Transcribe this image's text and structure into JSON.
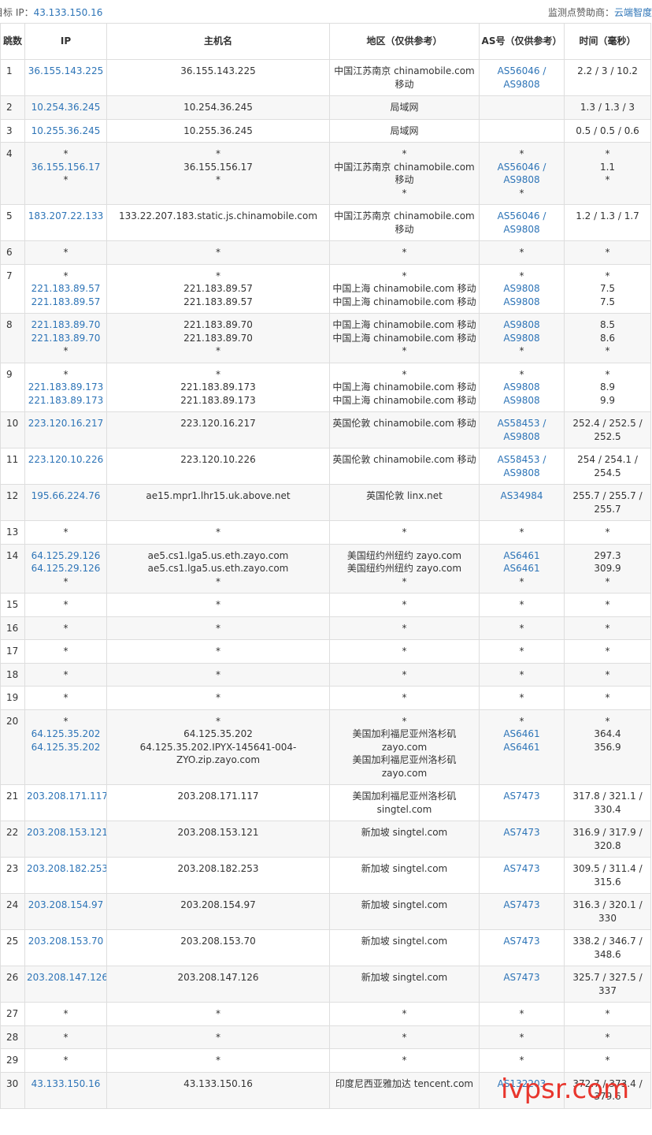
{
  "topbar": {
    "target_label": "目标 IP：",
    "target_ip": "43.133.150.16",
    "sponsor_label": "监测点赞助商：",
    "sponsor_name": "云端智度"
  },
  "table": {
    "headers": [
      "跳数",
      "IP",
      "主机名",
      "地区（仅供参考）",
      "AS号（仅供参考）",
      "时间（毫秒）"
    ],
    "rows": [
      {
        "hop": "1",
        "ip": [
          "36.155.143.225"
        ],
        "host": [
          "36.155.143.225"
        ],
        "region": [
          "中国江苏南京 chinamobile.com 移动"
        ],
        "as": [
          "AS56046 /",
          "AS9808"
        ],
        "time": [
          "2.2 / 3 / 10.2"
        ]
      },
      {
        "hop": "2",
        "ip": [
          "10.254.36.245"
        ],
        "host": [
          "10.254.36.245"
        ],
        "region": [
          "局域网"
        ],
        "as": [],
        "time": [
          "1.3 / 1.3 / 3"
        ]
      },
      {
        "hop": "3",
        "ip": [
          "10.255.36.245"
        ],
        "host": [
          "10.255.36.245"
        ],
        "region": [
          "局域网"
        ],
        "as": [],
        "time": [
          "0.5 / 0.5 / 0.6"
        ]
      },
      {
        "hop": "4",
        "ip": [
          "*",
          "36.155.156.17",
          "*"
        ],
        "host": [
          "*",
          "36.155.156.17",
          "*"
        ],
        "region": [
          "*",
          "中国江苏南京 chinamobile.com 移动",
          "*"
        ],
        "as": [
          "*",
          "AS56046 /",
          "AS9808",
          "*"
        ],
        "time": [
          "*",
          "1.1",
          "*"
        ]
      },
      {
        "hop": "5",
        "ip": [
          "183.207.22.133"
        ],
        "host": [
          "133.22.207.183.static.js.chinamobile.com"
        ],
        "region": [
          "中国江苏南京 chinamobile.com 移动"
        ],
        "as": [
          "AS56046 /",
          "AS9808"
        ],
        "time": [
          "1.2 / 1.3 / 1.7"
        ]
      },
      {
        "hop": "6",
        "ip": [
          "*"
        ],
        "host": [
          "*"
        ],
        "region": [
          "*"
        ],
        "as": [
          "*"
        ],
        "time": [
          "*"
        ]
      },
      {
        "hop": "7",
        "ip": [
          "*",
          "221.183.89.57",
          "221.183.89.57"
        ],
        "host": [
          "*",
          "221.183.89.57",
          "221.183.89.57"
        ],
        "region": [
          "*",
          "中国上海 chinamobile.com 移动",
          "中国上海 chinamobile.com 移动"
        ],
        "as": [
          "*",
          "AS9808",
          "AS9808"
        ],
        "time": [
          "*",
          "7.5",
          "7.5"
        ]
      },
      {
        "hop": "8",
        "ip": [
          "221.183.89.70",
          "221.183.89.70",
          "*"
        ],
        "host": [
          "221.183.89.70",
          "221.183.89.70",
          "*"
        ],
        "region": [
          "中国上海 chinamobile.com 移动",
          "中国上海 chinamobile.com 移动",
          "*"
        ],
        "as": [
          "AS9808",
          "AS9808",
          "*"
        ],
        "time": [
          "8.5",
          "8.6",
          "*"
        ]
      },
      {
        "hop": "9",
        "ip": [
          "*",
          "221.183.89.173",
          "221.183.89.173"
        ],
        "host": [
          "*",
          "221.183.89.173",
          "221.183.89.173"
        ],
        "region": [
          "*",
          "中国上海 chinamobile.com 移动",
          "中国上海 chinamobile.com 移动"
        ],
        "as": [
          "*",
          "AS9808",
          "AS9808"
        ],
        "time": [
          "*",
          "8.9",
          "9.9"
        ]
      },
      {
        "hop": "10",
        "ip": [
          "223.120.16.217"
        ],
        "host": [
          "223.120.16.217"
        ],
        "region": [
          "英国伦敦 chinamobile.com 移动"
        ],
        "as": [
          "AS58453 /",
          "AS9808"
        ],
        "time": [
          "252.4 / 252.5 /",
          "252.5"
        ]
      },
      {
        "hop": "11",
        "ip": [
          "223.120.10.226"
        ],
        "host": [
          "223.120.10.226"
        ],
        "region": [
          "英国伦敦 chinamobile.com 移动"
        ],
        "as": [
          "AS58453 /",
          "AS9808"
        ],
        "time": [
          "254 / 254.1 /",
          "254.5"
        ]
      },
      {
        "hop": "12",
        "ip": [
          "195.66.224.76"
        ],
        "host": [
          "ae15.mpr1.lhr15.uk.above.net"
        ],
        "region": [
          "英国伦敦 linx.net"
        ],
        "as": [
          "AS34984"
        ],
        "time": [
          "255.7 / 255.7 /",
          "255.7"
        ]
      },
      {
        "hop": "13",
        "ip": [
          "*"
        ],
        "host": [
          "*"
        ],
        "region": [
          "*"
        ],
        "as": [
          "*"
        ],
        "time": [
          "*"
        ]
      },
      {
        "hop": "14",
        "ip": [
          "64.125.29.126",
          "64.125.29.126",
          "*"
        ],
        "host": [
          "ae5.cs1.lga5.us.eth.zayo.com",
          "ae5.cs1.lga5.us.eth.zayo.com",
          "*"
        ],
        "region": [
          "美国纽约州纽约 zayo.com",
          "美国纽约州纽约 zayo.com",
          "*"
        ],
        "as": [
          "AS6461",
          "AS6461",
          "*"
        ],
        "time": [
          "297.3",
          "309.9",
          "*"
        ]
      },
      {
        "hop": "15",
        "ip": [
          "*"
        ],
        "host": [
          "*"
        ],
        "region": [
          "*"
        ],
        "as": [
          "*"
        ],
        "time": [
          "*"
        ]
      },
      {
        "hop": "16",
        "ip": [
          "*"
        ],
        "host": [
          "*"
        ],
        "region": [
          "*"
        ],
        "as": [
          "*"
        ],
        "time": [
          "*"
        ]
      },
      {
        "hop": "17",
        "ip": [
          "*"
        ],
        "host": [
          "*"
        ],
        "region": [
          "*"
        ],
        "as": [
          "*"
        ],
        "time": [
          "*"
        ]
      },
      {
        "hop": "18",
        "ip": [
          "*"
        ],
        "host": [
          "*"
        ],
        "region": [
          "*"
        ],
        "as": [
          "*"
        ],
        "time": [
          "*"
        ]
      },
      {
        "hop": "19",
        "ip": [
          "*"
        ],
        "host": [
          "*"
        ],
        "region": [
          "*"
        ],
        "as": [
          "*"
        ],
        "time": [
          "*"
        ]
      },
      {
        "hop": "20",
        "ip": [
          "*",
          "64.125.35.202",
          "64.125.35.202"
        ],
        "host": [
          "*",
          "64.125.35.202",
          "64.125.35.202.IPYX-145641-004-",
          "ZYO.zip.zayo.com"
        ],
        "region": [
          "*",
          "美国加利福尼亚州洛杉矶",
          "zayo.com",
          "美国加利福尼亚州洛杉矶",
          "zayo.com"
        ],
        "as": [
          "*",
          "AS6461",
          "AS6461"
        ],
        "time": [
          "*",
          "364.4",
          "356.9"
        ]
      },
      {
        "hop": "21",
        "ip": [
          "203.208.171.117"
        ],
        "host": [
          "203.208.171.117"
        ],
        "region": [
          "美国加利福尼亚州洛杉矶",
          "singtel.com"
        ],
        "as": [
          "AS7473"
        ],
        "time": [
          "317.8 / 321.1 /",
          "330.4"
        ]
      },
      {
        "hop": "22",
        "ip": [
          "203.208.153.121"
        ],
        "host": [
          "203.208.153.121"
        ],
        "region": [
          "新加坡 singtel.com"
        ],
        "as": [
          "AS7473"
        ],
        "time": [
          "316.9 / 317.9 /",
          "320.8"
        ]
      },
      {
        "hop": "23",
        "ip": [
          "203.208.182.253"
        ],
        "host": [
          "203.208.182.253"
        ],
        "region": [
          "新加坡 singtel.com"
        ],
        "as": [
          "AS7473"
        ],
        "time": [
          "309.5 / 311.4 /",
          "315.6"
        ]
      },
      {
        "hop": "24",
        "ip": [
          "203.208.154.97"
        ],
        "host": [
          "203.208.154.97"
        ],
        "region": [
          "新加坡 singtel.com"
        ],
        "as": [
          "AS7473"
        ],
        "time": [
          "316.3 / 320.1 /",
          "330"
        ]
      },
      {
        "hop": "25",
        "ip": [
          "203.208.153.70"
        ],
        "host": [
          "203.208.153.70"
        ],
        "region": [
          "新加坡 singtel.com"
        ],
        "as": [
          "AS7473"
        ],
        "time": [
          "338.2 / 346.7 /",
          "348.6"
        ]
      },
      {
        "hop": "26",
        "ip": [
          "203.208.147.126"
        ],
        "host": [
          "203.208.147.126"
        ],
        "region": [
          "新加坡 singtel.com"
        ],
        "as": [
          "AS7473"
        ],
        "time": [
          "325.7 / 327.5 /",
          "337"
        ]
      },
      {
        "hop": "27",
        "ip": [
          "*"
        ],
        "host": [
          "*"
        ],
        "region": [
          "*"
        ],
        "as": [
          "*"
        ],
        "time": [
          "*"
        ]
      },
      {
        "hop": "28",
        "ip": [
          "*"
        ],
        "host": [
          "*"
        ],
        "region": [
          "*"
        ],
        "as": [
          "*"
        ],
        "time": [
          "*"
        ]
      },
      {
        "hop": "29",
        "ip": [
          "*"
        ],
        "host": [
          "*"
        ],
        "region": [
          "*"
        ],
        "as": [
          "*"
        ],
        "time": [
          "*"
        ]
      },
      {
        "hop": "30",
        "ip": [
          "43.133.150.16"
        ],
        "host": [
          "43.133.150.16"
        ],
        "region": [
          "印度尼西亚雅加达 tencent.com"
        ],
        "as": [
          "AS132203"
        ],
        "time": [
          "372.7 / 373.4 /",
          "379.6"
        ]
      }
    ]
  },
  "watermark": "ivpsr.com",
  "colors": {
    "link": "#2d74b7",
    "border": "#dedede",
    "stripe": "#f7f7f7",
    "watermark": "#e8362d"
  }
}
